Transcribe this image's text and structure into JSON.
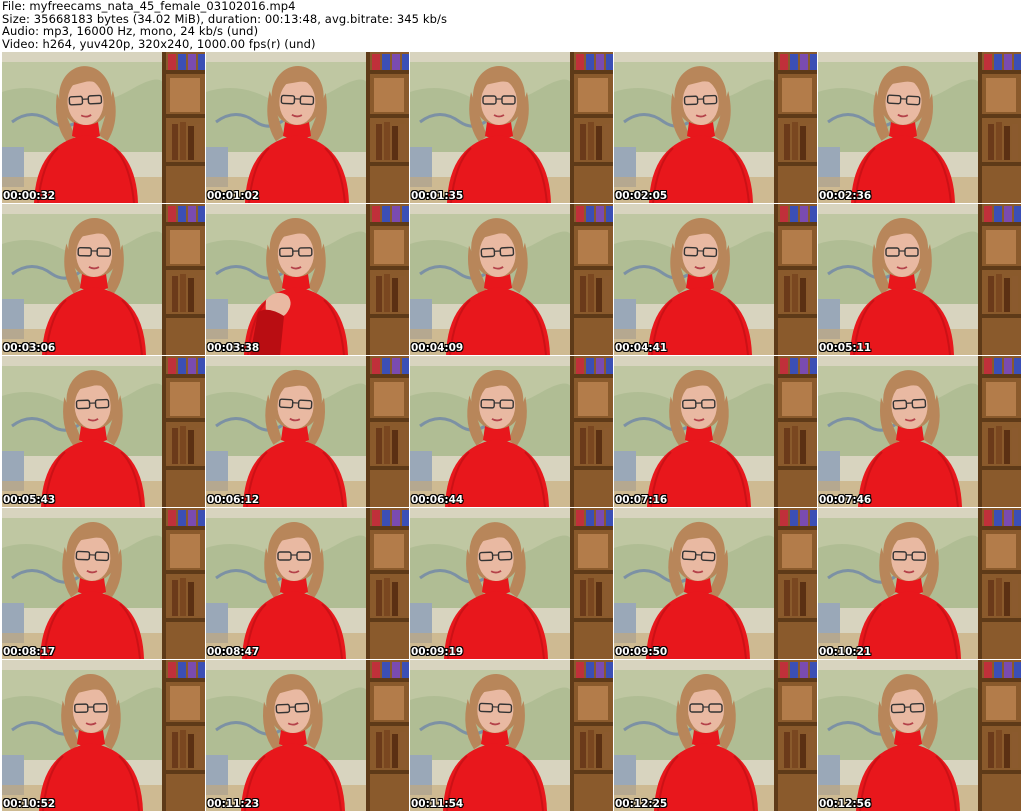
{
  "header": {
    "file_line": "File: myfreecams_nata_45_female_03102016.mp4",
    "size_line": "Size: 35668183 bytes (34.02 MiB), duration: 00:13:48, avg.bitrate: 345 kb/s",
    "audio_line": "Audio: mp3, 16000 Hz, mono, 24 kb/s (und)",
    "video_line": "Video: h264, yuv420p, 320x240, 1000.00 fps(r) (und)"
  },
  "colors": {
    "sweater": "#e8171c",
    "sweater_dark": "#b90d12",
    "wall": "#d8d4bf",
    "map": "#bfc7a2",
    "shelf": "#8a5a2c",
    "shelf_dark": "#5e3a18",
    "hair": "#b8865a",
    "skin": "#e9b9a2",
    "binder_blue": "#3b4fb5",
    "binder_purple": "#7a4bb0",
    "binder_red": "#c0303a"
  },
  "thumbnails": [
    {
      "timestamp": "00:00:32"
    },
    {
      "timestamp": "00:01:02"
    },
    {
      "timestamp": "00:01:35"
    },
    {
      "timestamp": "00:02:05"
    },
    {
      "timestamp": "00:02:36"
    },
    {
      "timestamp": "00:03:06"
    },
    {
      "timestamp": "00:03:38",
      "hand_on_chin": true
    },
    {
      "timestamp": "00:04:09"
    },
    {
      "timestamp": "00:04:41"
    },
    {
      "timestamp": "00:05:11"
    },
    {
      "timestamp": "00:05:43"
    },
    {
      "timestamp": "00:06:12"
    },
    {
      "timestamp": "00:06:44"
    },
    {
      "timestamp": "00:07:16"
    },
    {
      "timestamp": "00:07:46"
    },
    {
      "timestamp": "00:08:17"
    },
    {
      "timestamp": "00:08:47"
    },
    {
      "timestamp": "00:09:19"
    },
    {
      "timestamp": "00:09:50"
    },
    {
      "timestamp": "00:10:21"
    },
    {
      "timestamp": "00:10:52"
    },
    {
      "timestamp": "00:11:23"
    },
    {
      "timestamp": "00:11:54"
    },
    {
      "timestamp": "00:12:25"
    },
    {
      "timestamp": "00:12:56"
    }
  ]
}
